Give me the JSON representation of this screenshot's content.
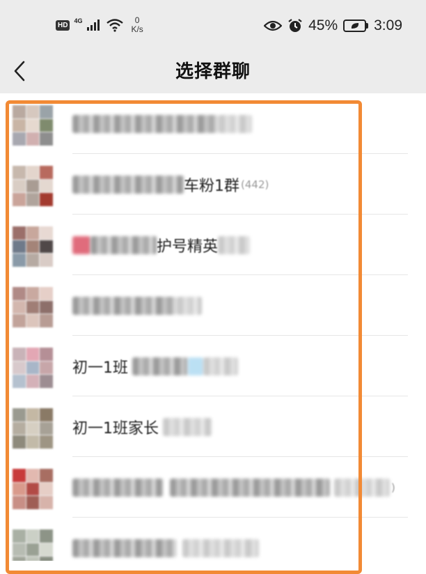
{
  "status_bar": {
    "hd_badge": "HD",
    "network_type": "4G",
    "speed_value": "0",
    "speed_unit": "K/s",
    "battery_percent": "45%",
    "time": "3:09",
    "icons": [
      "signal-icon",
      "wifi-icon",
      "eye-icon",
      "alarm-icon",
      "battery-icon"
    ]
  },
  "header": {
    "title": "选择群聊",
    "back_icon": "chevron-left-icon"
  },
  "group_list": [
    {
      "name_visible": "",
      "count": ""
    },
    {
      "name_visible": "车粉1群",
      "count": "(442)"
    },
    {
      "name_visible": "护号精英",
      "count": ""
    },
    {
      "name_visible": "",
      "count": ""
    },
    {
      "name_visible": "初一1班",
      "count": ""
    },
    {
      "name_visible": "初一1班家长",
      "count": ""
    },
    {
      "name_visible": "",
      "count": ")"
    },
    {
      "name_visible": "",
      "count": ""
    }
  ],
  "highlight_color": "#f28a35"
}
